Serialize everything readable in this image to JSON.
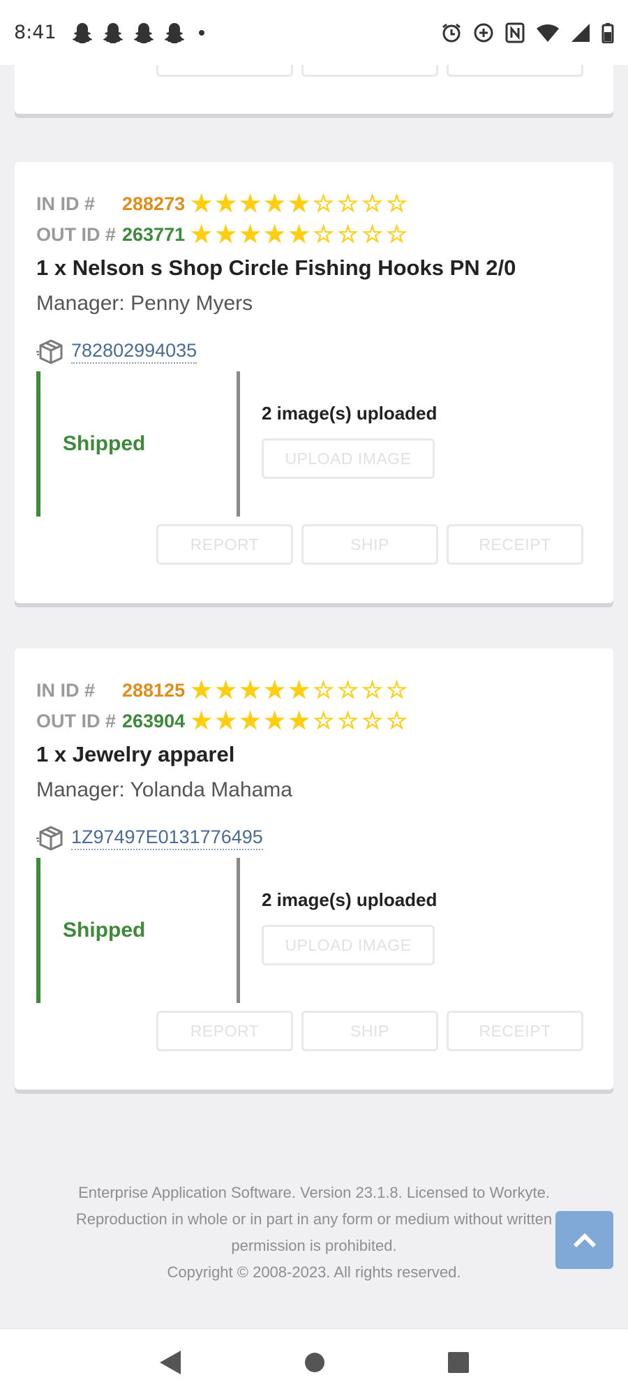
{
  "status_bar": {
    "time": "8:41",
    "notification_icons": [
      "snapchat-icon",
      "snapchat-icon",
      "snapchat-icon",
      "snapchat-icon"
    ],
    "system_icons": [
      "alarm-icon",
      "data-saver-icon",
      "nfc-icon",
      "wifi-icon",
      "signal-icon",
      "battery-icon"
    ]
  },
  "top_card": {
    "buttons": [
      "",
      "",
      ""
    ]
  },
  "labels": {
    "in_id": "IN ID #",
    "out_id": "OUT ID #",
    "manager_prefix": "Manager: "
  },
  "orders": [
    {
      "in_id": "288273",
      "in_rating": 5,
      "out_id": "263771",
      "out_rating": 5,
      "title": "1 x Nelson s Shop Circle Fishing Hooks PN 2/0",
      "manager": "Penny Myers",
      "tracking": "782802994035",
      "status": "Shipped",
      "images_uploaded": "2 image(s) uploaded",
      "upload_button": "UPLOAD IMAGE",
      "buttons": {
        "report": "REPORT",
        "ship": "SHIP",
        "receipt": "RECEIPT"
      }
    },
    {
      "in_id": "288125",
      "in_rating": 5,
      "out_id": "263904",
      "out_rating": 5,
      "title": "1 x Jewelry apparel",
      "manager": "Yolanda Mahama",
      "tracking": "1Z97497E0131776495",
      "status": "Shipped",
      "images_uploaded": "2 image(s) uploaded",
      "upload_button": "UPLOAD IMAGE",
      "buttons": {
        "report": "REPORT",
        "ship": "SHIP",
        "receipt": "RECEIPT"
      }
    }
  ],
  "rating_max": 9,
  "footer": {
    "line1": "Enterprise Application Software. Version 23.1.8. Licensed to Workyte.",
    "line2": "Reproduction in whole or in part in any form or medium without written",
    "line3": "permission is prohibited.",
    "line4": "Copyright © 2008-2023. All rights reserved."
  },
  "colors": {
    "in_id": "#e08e1b",
    "out_id": "#3c8a3a",
    "star": "#ffce10",
    "shipped": "#3c8a3a",
    "link": "#4a6b96",
    "scroll_button": "#5b91ce"
  },
  "nav": {
    "icons": [
      "back-icon",
      "home-icon",
      "recents-icon"
    ]
  }
}
